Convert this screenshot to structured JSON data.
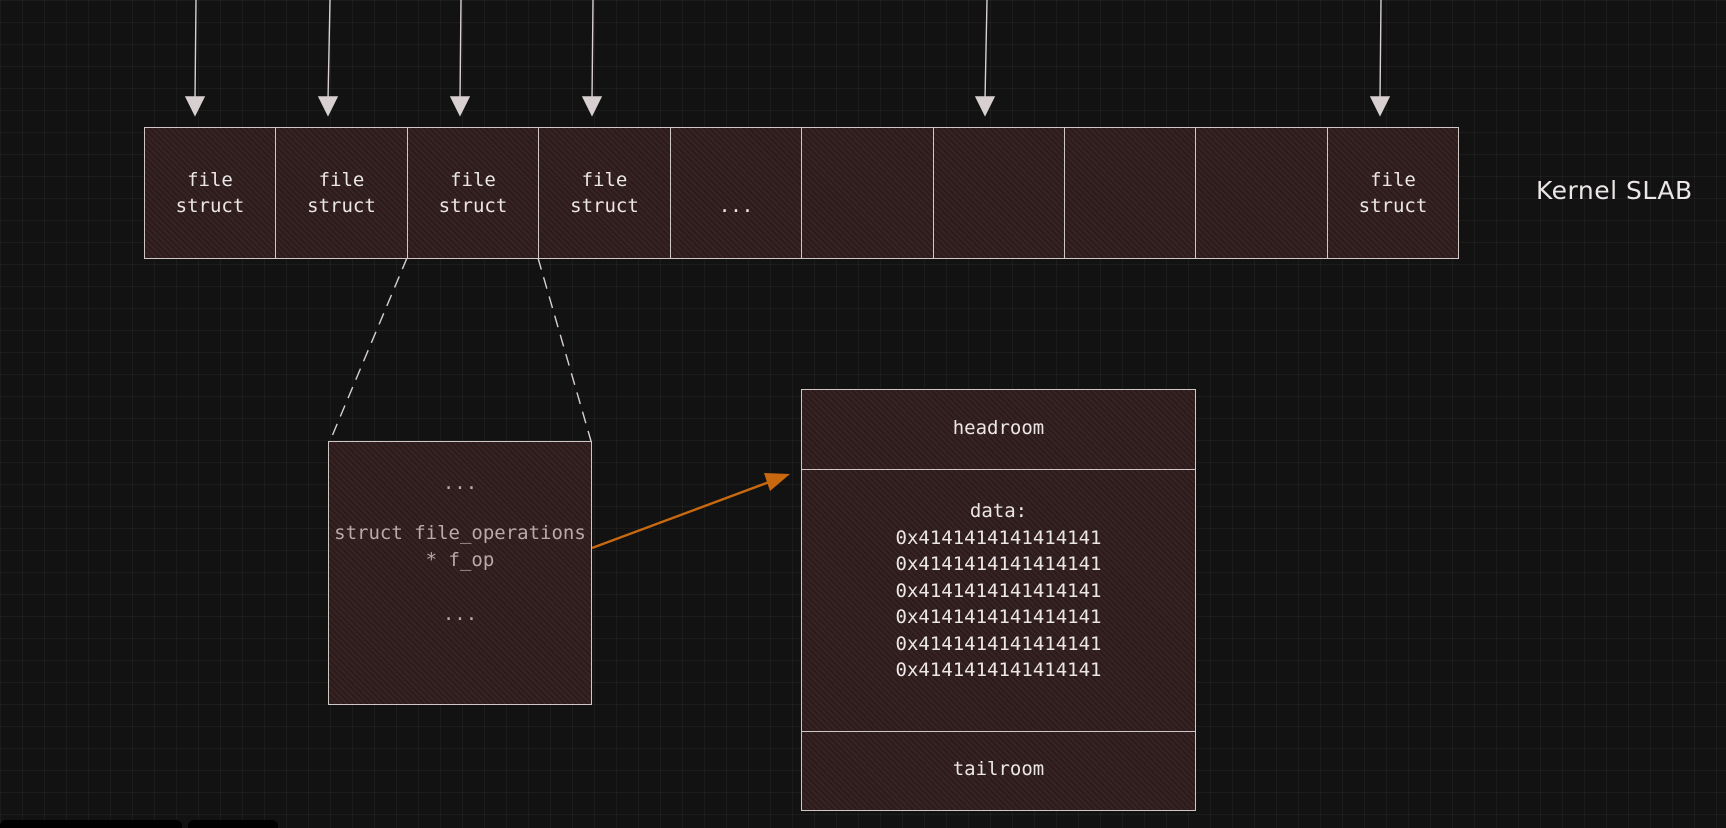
{
  "slab": {
    "label": "Kernel SLAB",
    "cells": [
      {
        "line1": "file",
        "line2": "struct"
      },
      {
        "line1": "file",
        "line2": "struct"
      },
      {
        "line1": "file",
        "line2": "struct"
      },
      {
        "line1": "file",
        "line2": "struct"
      },
      {
        "line1": "...",
        "line2": ""
      },
      {
        "line1": "",
        "line2": ""
      },
      {
        "line1": "",
        "line2": ""
      },
      {
        "line1": "",
        "line2": ""
      },
      {
        "line1": "",
        "line2": ""
      },
      {
        "line1": "file",
        "line2": "struct"
      }
    ]
  },
  "file_struct_detail": {
    "top_ellipsis": "...",
    "field_line1": "struct file_operations",
    "field_line2": "* f_op",
    "bottom_ellipsis": "..."
  },
  "buffer": {
    "headroom": "headroom",
    "data_label": "data:",
    "data_values": [
      "0x4141414141414141",
      "0x4141414141414141",
      "0x4141414141414141",
      "0x4141414141414141",
      "0x4141414141414141",
      "0x4141414141414141"
    ],
    "tailroom": "tailroom"
  },
  "colors": {
    "pointer_arrow": "#c8690f",
    "lines": "#d8d0d0",
    "box_fill": "#2a1c1c"
  }
}
